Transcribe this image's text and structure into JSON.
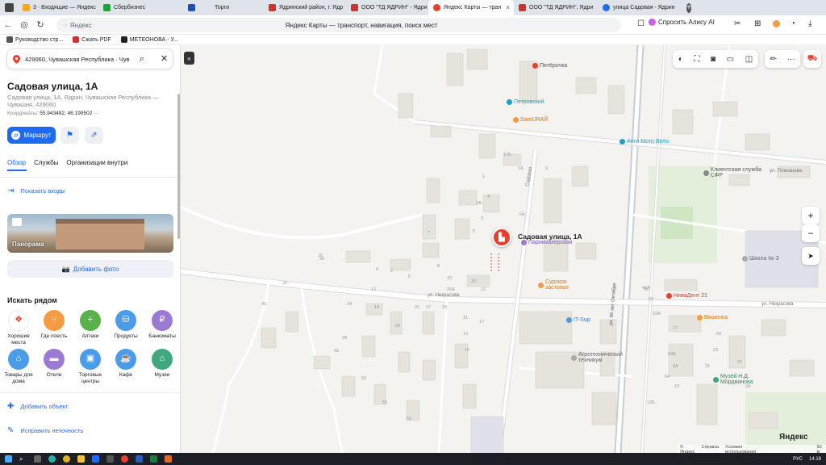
{
  "browser": {
    "tabs": [
      {
        "label": "3 · Входящие — Яндекс",
        "color": "#f5a623"
      },
      {
        "label": "Сбербизнес",
        "color": "#21a038"
      },
      {
        "label": "Торги",
        "color": "#1e4fb3"
      },
      {
        "label": "Ядринский район, г. Ядр",
        "color": "#d62d2d"
      },
      {
        "label": "ООО \"ТД ЯДРИН\" - Ядри",
        "color": "#d62d2d"
      },
      {
        "label": "Яндекс Карты — тран",
        "color": "#e8402f",
        "active": true
      },
      {
        "label": "ООО \"ТД ЯДРИН\", Ядри",
        "color": "#d62d2d"
      },
      {
        "label": "улица Садовая - Ядрин",
        "color": "#1f6bf0"
      }
    ],
    "tab_close": "×",
    "new_tab": "+",
    "address_prefix": "Яндекс",
    "page_title": "Яндекс Карты — транспорт, навигация, поиск мест",
    "alice": "Спросить Алису AI",
    "bookmarks": [
      {
        "label": "Руководство стр...",
        "color": "#555"
      },
      {
        "label": "Сжать PDF",
        "color": "#d62d2d"
      },
      {
        "label": "МЕТЕОНОВА - У...",
        "color": "#222"
      }
    ]
  },
  "panel": {
    "search_value": "429060, Чувашская Республика · Чув",
    "title": "Садовая улица, 1А",
    "address": "Садовая улица, 1А, Ядрин, Чувашская Республика — Чувашия, 429060",
    "coords_label": "Координаты:",
    "coords_value": "55.943492, 46.199502",
    "route_label": "Маршрут",
    "tabs": [
      "Обзор",
      "Службы",
      "Организации внутри"
    ],
    "show_entrances": "Показать входы",
    "panorama": "Панорама",
    "add_photo": "Добавить фото",
    "nearby_title": "Искать рядом",
    "categories": [
      {
        "label": "Хорошие места",
        "color": "#ffffff",
        "icon": "✦"
      },
      {
        "label": "Где поесть",
        "color": "#f59b42",
        "icon": "⑂"
      },
      {
        "label": "Аптеки",
        "color": "#5ab04a",
        "icon": "+"
      },
      {
        "label": "Продукты",
        "color": "#4a9be8",
        "icon": "⛁"
      },
      {
        "label": "Банкоматы",
        "color": "#9b7ad3",
        "icon": "₽"
      },
      {
        "label": "Товары для дома",
        "color": "#4a9be8",
        "icon": "⌂"
      },
      {
        "label": "Отели",
        "color": "#9b7ad3",
        "icon": "▬"
      },
      {
        "label": "Торговые центры",
        "color": "#4a9be8",
        "icon": "▣"
      },
      {
        "label": "Кафе",
        "color": "#4a9be8",
        "icon": "☕"
      },
      {
        "label": "Музеи",
        "color": "#3fa87c",
        "icon": "⌂"
      }
    ],
    "add_object": "Добавить объект",
    "fix_error": "Исправить неточность"
  },
  "map": {
    "marker_label": "Садовая улица, 1А",
    "pois": [
      {
        "label": "Пятёрочка",
        "color": "#e8402f"
      },
      {
        "label": "Петровский",
        "color": "#1fa0c7"
      },
      {
        "label": "SamURAЙ",
        "color": "#f59b42"
      },
      {
        "label": "Авто Мото Вело",
        "color": "#1fa0c7"
      },
      {
        "label": "Клиентская служба СФР",
        "color": "#888"
      },
      {
        "label": "Парикмахерская",
        "color": "#9b7ad3"
      },
      {
        "label": "Сурское застолье",
        "color": "#f59b42"
      },
      {
        "label": "Школа № 3",
        "color": "#888"
      },
      {
        "label": "НиваДент 21",
        "color": "#e8402f"
      },
      {
        "label": "IT-Sup",
        "color": "#4a9be8"
      },
      {
        "label": "Вишенка",
        "color": "#f59b42"
      },
      {
        "label": "Агротехнический техникум",
        "color": "#888"
      },
      {
        "label": "Музей Н.Д. Мордвинова",
        "color": "#3fa87c"
      }
    ],
    "streets": {
      "nekrasova_left": "ул. Некрасова",
      "nekrasova_right": "ул. Некрасова",
      "plekhanova": "ул. Плеханова",
      "sadovaya": "Садовая",
      "let_oktyabrya": "ул. 50 лет Октября"
    },
    "house_numbers": [
      "17Б",
      "1А",
      "1",
      "4",
      "3А",
      "3",
      "5",
      "7",
      "6А",
      "9",
      "16",
      "2",
      "4",
      "6",
      "8",
      "10",
      "12",
      "14",
      "21",
      "27",
      "29",
      "31",
      "13",
      "15",
      "17",
      "20",
      "22",
      "26А",
      "26",
      "24",
      "28",
      "30",
      "32",
      "46",
      "48",
      "50",
      "55",
      "56",
      "58",
      "60",
      "19А",
      "17",
      "2А",
      "19",
      "21",
      "23",
      "27",
      "3А",
      "46А",
      "60",
      "64А",
      "64",
      "13Б"
    ],
    "brand": "Яндекс",
    "footer": [
      "© Яндекс",
      "Справка",
      "Условия использования",
      "50 м"
    ]
  },
  "taskbar": {
    "lang": "РУС",
    "time": "14:18"
  }
}
